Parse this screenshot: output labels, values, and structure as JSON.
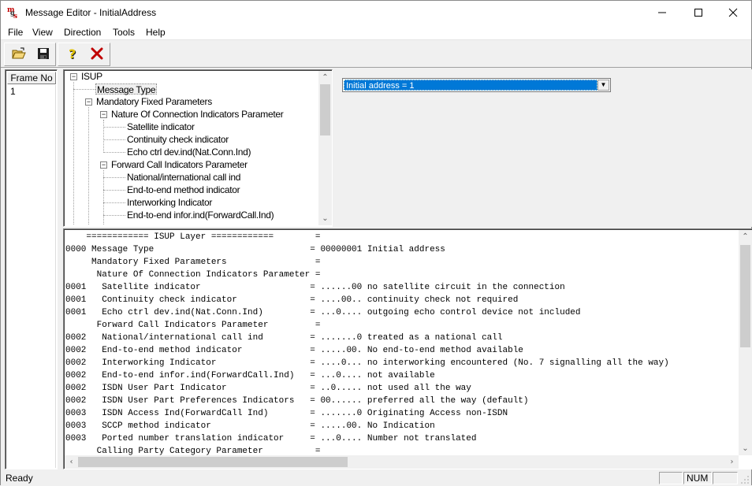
{
  "window": {
    "title": "Message Editor - InitialAddress",
    "minimize": "—",
    "maximize": "☐",
    "close": "✕"
  },
  "menu": [
    "File",
    "View",
    "Direction",
    "Tools",
    "Help"
  ],
  "toolbar": {
    "open_icon": "folder-open-icon",
    "save_icon": "floppy-disk-icon",
    "help_icon": "question-mark-icon",
    "delete_icon": "red-x-icon"
  },
  "frames": {
    "header": "Frame No",
    "rows": [
      "1"
    ]
  },
  "tree": {
    "root": "ISUP",
    "message_type": "Message Type",
    "mandatory_fixed": "Mandatory Fixed Parameters",
    "nature_conn": "Nature Of Connection Indicators Parameter",
    "satellite": "Satellite indicator",
    "continuity": "Continuity check indicator",
    "echo": "Echo ctrl dev.ind(Nat.Conn.Ind)",
    "forward_call": "Forward Call Indicators Parameter",
    "national": "National/international call ind",
    "end_to_end": "End-to-end method indicator",
    "interworking": "Interworking Indicator",
    "end_to_end_infor": "End-to-end infor.ind(ForwardCall.Ind)"
  },
  "combo": {
    "value": "Initial address = 1",
    "arrow": "▼"
  },
  "decode": {
    "lines": [
      "    ============ ISUP Layer ============        =",
      "0000 Message Type                              = 00000001 Initial address",
      "     Mandatory Fixed Parameters                 =",
      "      Nature Of Connection Indicators Parameter =",
      "0001   Satellite indicator                     = ......00 no satellite circuit in the connection",
      "0001   Continuity check indicator              = ....00.. continuity check not required",
      "0001   Echo ctrl dev.ind(Nat.Conn.Ind)         = ...0.... outgoing echo control device not included",
      "      Forward Call Indicators Parameter         =",
      "0002   National/international call ind         = .......0 treated as a national call",
      "0002   End-to-end method indicator             = .....00. No end-to-end method available",
      "0002   Interworking Indicator                  = ....0... no interworking encountered (No. 7 signalling all the way)",
      "0002   End-to-end infor.ind(ForwardCall.Ind)   = ...0.... not available",
      "0002   ISDN User Part Indicator                = ..0..... not used all the way",
      "0002   ISDN User Part Preferences Indicators   = 00...... preferred all the way (default)",
      "0003   ISDN Access Ind(ForwardCall Ind)        = .......0 Originating Access non-ISDN",
      "0003   SCCP method indicator                   = .....00. No Indication",
      "0003   Ported number translation indicator     = ...0.... Number not translated",
      "      Calling Party Category Parameter          ="
    ]
  },
  "status": {
    "text": "Ready",
    "num": "NUM"
  },
  "colors": {
    "selection": "#0078d7",
    "delete_red": "#c00000"
  }
}
